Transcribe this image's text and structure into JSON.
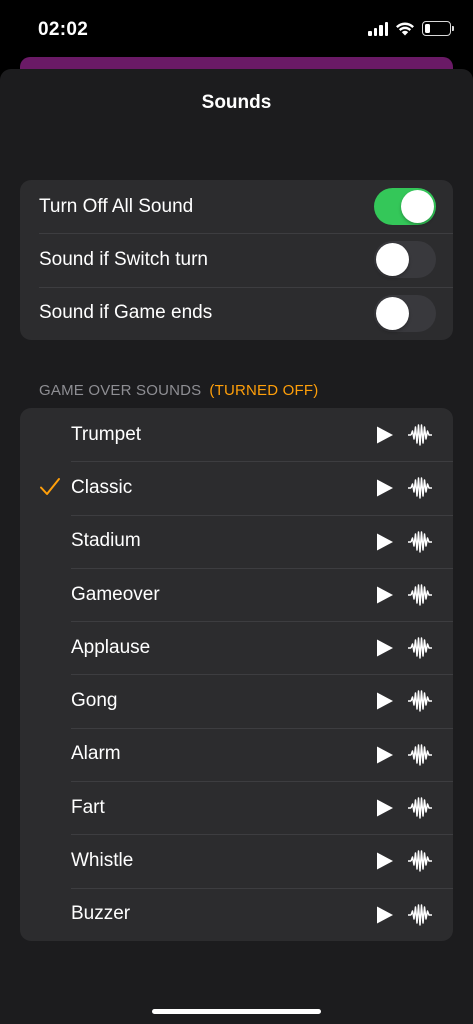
{
  "status_bar": {
    "time": "02:02",
    "icons": [
      "signal-icon",
      "wifi-icon",
      "battery-icon"
    ],
    "battery_level": 0.22
  },
  "sheet": {
    "title": "Sounds"
  },
  "toggles": [
    {
      "label": "Turn Off All Sound",
      "on": true
    },
    {
      "label": "Sound if Switch turn",
      "on": false
    },
    {
      "label": "Sound if Game ends",
      "on": false
    }
  ],
  "section": {
    "title": "GAME OVER SOUNDS",
    "note": "(TURNED OFF)"
  },
  "sounds": [
    {
      "label": "Trumpet",
      "selected": false
    },
    {
      "label": "Classic",
      "selected": true
    },
    {
      "label": "Stadium",
      "selected": false
    },
    {
      "label": "Gameover",
      "selected": false
    },
    {
      "label": "Applause",
      "selected": false
    },
    {
      "label": "Gong",
      "selected": false
    },
    {
      "label": "Alarm",
      "selected": false
    },
    {
      "label": "Fart",
      "selected": false
    },
    {
      "label": "Whistle",
      "selected": false
    },
    {
      "label": "Buzzer",
      "selected": false
    }
  ],
  "colors": {
    "accent": "#ff9f0a",
    "switch_on": "#34c759",
    "background": "#000000",
    "sheet": "#1c1c1e",
    "group": "#2c2c2e",
    "behind_app": "#6a1a66"
  }
}
